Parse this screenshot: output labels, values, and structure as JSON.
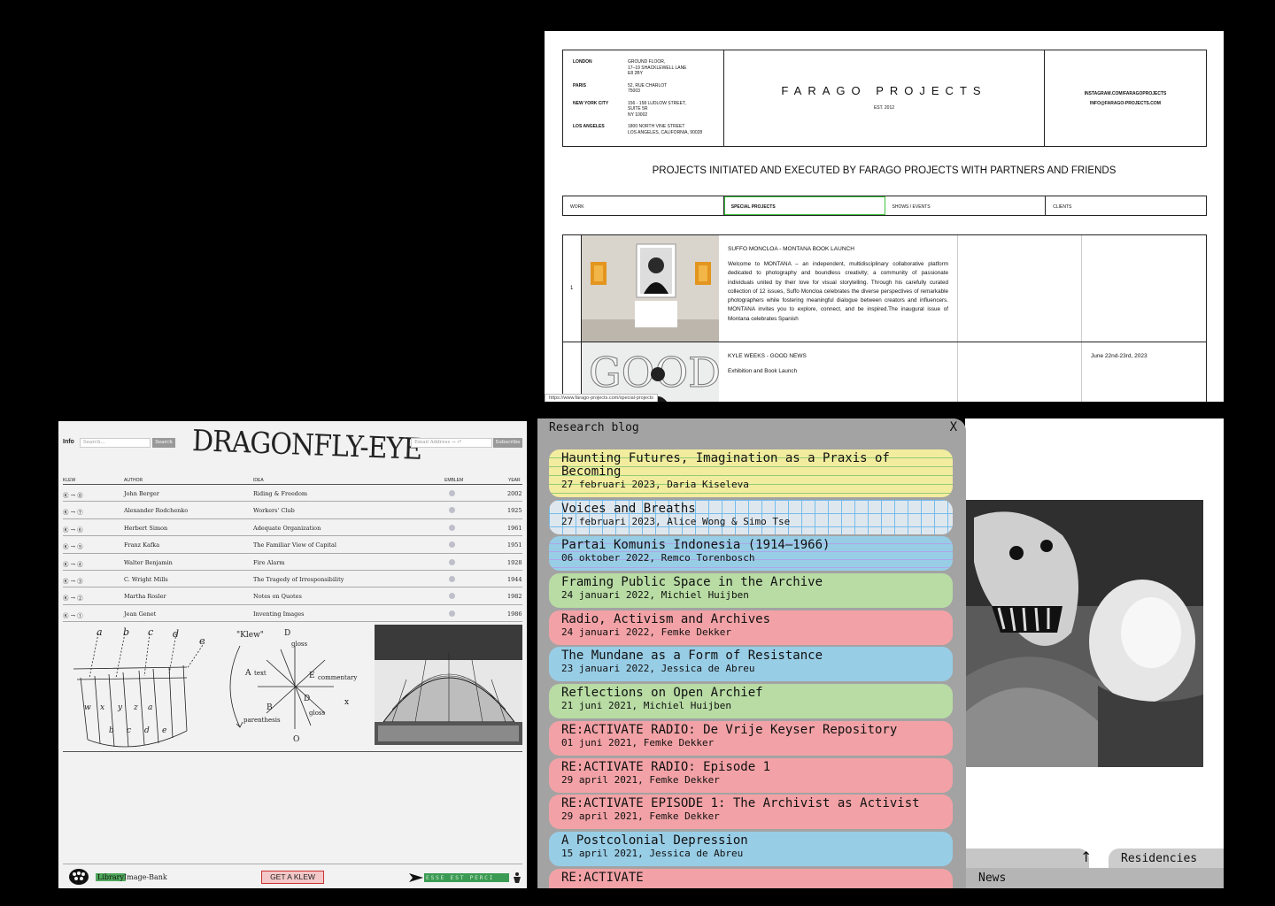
{
  "farago": {
    "offices": [
      {
        "city": "LONDON",
        "address": "GROUND FLOOR,\n17–19 SHACKLEWELL LANE\nE8 2BY"
      },
      {
        "city": "PARIS",
        "address": "52, RUE CHARLOT\n75003"
      },
      {
        "city": "NEW YORK CITY",
        "address": "156 - 158 LUDLOW STREET,\nSUITE 5R\nNY 10002"
      },
      {
        "city": "LOS ANGELES",
        "address": "1800 NORTH VINE STREET\nLOS ANGELES, CALIFORNIA, 90028"
      }
    ],
    "brand": "FARAGO PROJECTS",
    "est": "EST. 2012",
    "instagram": "INSTAGRAM.COM/FARAGOPROJECTS",
    "email": "INFO@FARAGO-PROJECTS.COM",
    "heading": "PROJECTS INITIATED AND EXECUTED BY FARAGO PROJECTS WITH PARTNERS AND FRIENDS",
    "tabs": [
      "WORK",
      "SPECIAL PROJECTS",
      "SHOWS / EVENTS",
      "CLIENTS"
    ],
    "projects": [
      {
        "num": "1",
        "title": "SUFFO MONCLOA - MONTANA BOOK LAUNCH",
        "desc": "Welcome to MONTANA – an independent, multidisciplinary collaborative platform dedicated to photography and boundless creativity; a community of passionate individuals united by their love for visual storytelling. Through his carefully curated collection of 12 issues, Suffo Moncloa celebrates the diverse perspectives of remarkable photographers while fostering meaningful dialogue between creators and influencers. MONTANA invites you to explore, connect, and be inspired.The inaugural issue of Montana celebrates Spanish",
        "date": ""
      },
      {
        "num": "",
        "title": "KYLE WEEKS - GOOD NEWS",
        "desc": "Exhibition and Book Launch",
        "date": "June 22nd-23rd, 2023"
      }
    ],
    "status_url": "https://www.farago-projects.com/special-projects"
  },
  "dragonfly": {
    "info": "Info",
    "search_placeholder": "Search...",
    "search_button": "Search",
    "logo": "DRAGONFLY-EYE",
    "email_placeholder": "Email Address → ⏎",
    "subscribe_button": "Subscribe",
    "columns": {
      "klew": "KLEW",
      "author": "AUTHOR",
      "idea": "IDEA",
      "emblem": "EMBLEM",
      "year": "YEAR"
    },
    "rows": [
      {
        "klew": "Ⓚ → ⑧",
        "author": "John Berger",
        "idea": "Riding & Freedom",
        "year": "2002"
      },
      {
        "klew": "Ⓚ → ⑦",
        "author": "Alexander Rodchenko",
        "idea": "Workers' Club",
        "year": "1925"
      },
      {
        "klew": "Ⓚ → ⑥",
        "author": "Herbert Simon",
        "idea": "Adequate Organization",
        "year": "1961"
      },
      {
        "klew": "Ⓚ → ⑤",
        "author": "Franz Kafka",
        "idea": "The Familiar View of Capital",
        "year": "1951"
      },
      {
        "klew": "Ⓚ → ④",
        "author": "Walter Benjamin",
        "idea": "Fire Alarm",
        "year": "1928"
      },
      {
        "klew": "Ⓚ → ③",
        "author": "C. Wright Mills",
        "idea": "The Tragedy of Irresponsibility",
        "year": "1944"
      },
      {
        "klew": "Ⓚ → ②",
        "author": "Martha Rosler",
        "idea": "Notes on Quotes",
        "year": "1982"
      },
      {
        "klew": "Ⓚ → ①",
        "author": "Jean Genet",
        "idea": "Inventing Images",
        "year": "1986"
      }
    ],
    "diagram_letters_top": [
      "a",
      "b",
      "c",
      "d",
      "e"
    ],
    "diagram_letters_bottom": [
      "w",
      "x",
      "y",
      "z",
      "a",
      "b",
      "c",
      "d",
      "e"
    ],
    "star": {
      "klew": "\"Klew\"",
      "d": "D",
      "gloss": "gloss",
      "a": "A",
      "text": "text",
      "e": "E",
      "commentary": "commentary",
      "b": "B",
      "parenthesis": "parenthesis",
      "d2": "D",
      "gloss2": "gloss",
      "x": "x",
      "o": "O"
    },
    "library": "Library",
    "image_bank": "Image-Bank",
    "get_klew": "GET A KLEW",
    "motto": "ESSE EST PERCI"
  },
  "research": {
    "title": "Research blog",
    "close": "X",
    "posts": [
      {
        "title": "Haunting Futures, Imagination as a Praxis of Becoming",
        "meta": "27 februari 2023, Daria Kiseleva",
        "color": "yellow"
      },
      {
        "title": "Voices and Breaths",
        "meta": "27 februari 2023, Alice Wong & Simo Tse",
        "color": "grid"
      },
      {
        "title": "Partai Komunis Indonesia (1914–1966)",
        "meta": "06 oktober 2022, Remco Torenbosch",
        "color": "blue-lined"
      },
      {
        "title": "Framing Public Space in the Archive",
        "meta": "24 januari 2022, Michiel Huijben",
        "color": "green"
      },
      {
        "title": "Radio, Activism and Archives",
        "meta": "24 januari 2022, Femke Dekker",
        "color": "red"
      },
      {
        "title": "The Mundane as a Form of Resistance",
        "meta": "23 januari 2022, Jessica de Abreu",
        "color": "blue"
      },
      {
        "title": "Reflections on Open Archief",
        "meta": "21 juni 2021, Michiel Huijben",
        "color": "green"
      },
      {
        "title": "RE:ACTIVATE RADIO: De Vrije Keyser Repository",
        "meta": "01 juni 2021, Femke Dekker",
        "color": "red"
      },
      {
        "title": "RE:ACTIVATE RADIO: Episode 1",
        "meta": "29 april 2021, Femke Dekker",
        "color": "red"
      },
      {
        "title": "RE:ACTIVATE EPISODE 1: The Archivist as Activist",
        "meta": "29 april 2021, Femke Dekker",
        "color": "red"
      },
      {
        "title": "A Postcolonial Depression",
        "meta": "15 april 2021, Jessica de Abreu",
        "color": "blue"
      },
      {
        "title": "RE:ACTIVATE",
        "meta": "",
        "color": "red"
      }
    ]
  },
  "photo_page": {
    "arrow": "↑",
    "residencies": "Residencies",
    "news": "News"
  }
}
